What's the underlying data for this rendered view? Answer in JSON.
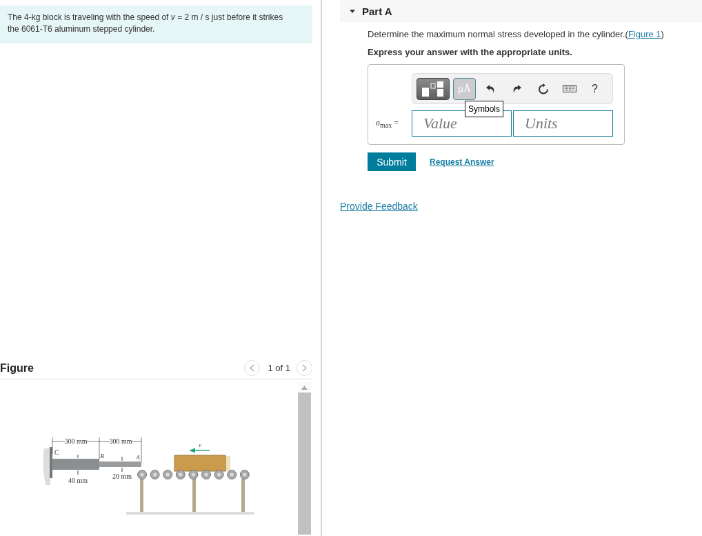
{
  "problem": {
    "text": "The 4-kg block is traveling with the speed of *v* = 2 m / s just before it strikes the 6061-T6 aluminum stepped cylinder."
  },
  "figure_panel": {
    "title": "Figure",
    "pager": "1 of 1",
    "labels": [
      "300 mm",
      "300 mm",
      "C",
      "B",
      "A",
      "v",
      "40 mm",
      "20 mm"
    ]
  },
  "part": {
    "title": "Part A",
    "prompt": [
      "Determine the maximum normal stress developed in the cylinder.(",
      ")"
    ],
    "link": "Figure 1",
    "instruction": "Express your answer with the appropriate units.",
    "symbols_button": "μÅ",
    "help": "?",
    "tooltip": "Symbols",
    "variable": "*σ*$_{max}$ =",
    "value": {
      "placeholder": "Value"
    },
    "units": {
      "placeholder": "Units"
    },
    "submit": "Submit",
    "request": "Request Answer"
  },
  "feedback": "Provide Feedback"
}
